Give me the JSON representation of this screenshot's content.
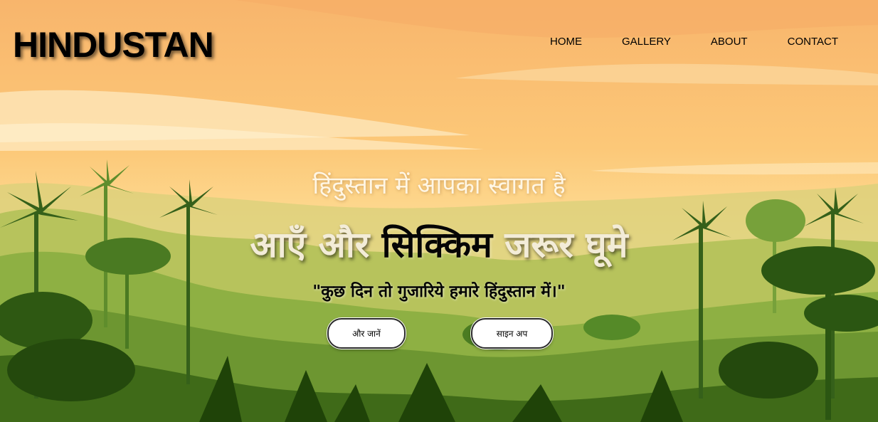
{
  "brand": {
    "title": "HINDUSTAN"
  },
  "nav": {
    "items": [
      {
        "label": "HOME"
      },
      {
        "label": "GALLERY"
      },
      {
        "label": "ABOUT"
      },
      {
        "label": "CONTACT"
      }
    ]
  },
  "hero": {
    "welcome": "हिंदुस्तान में आपका स्वागत है",
    "headline_part1": "आएँ और ",
    "headline_highlight": "सिक्किम",
    "headline_part2": " जरूर घूमे",
    "quote": "\"कुछ दिन तो गुजारिये हमारे हिंदुस्तान में।\"",
    "buttons": {
      "learn_more": "और जानें",
      "sign_up": "साइन अप"
    }
  },
  "colors": {
    "sky_top": "#f7b46a",
    "sky_bottom": "#fde29a",
    "foliage_light": "#b5c45a",
    "foliage_mid": "#7ea43c",
    "foliage_dark": "#2e5512"
  }
}
